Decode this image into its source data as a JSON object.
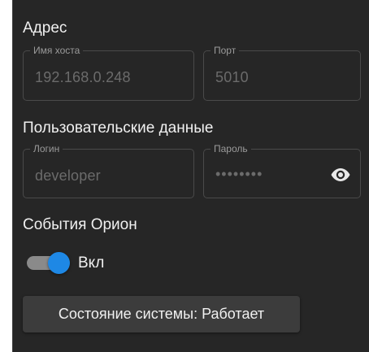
{
  "address": {
    "title": "Адрес",
    "host": {
      "label": "Имя хоста",
      "value": "192.168.0.248"
    },
    "port": {
      "label": "Порт",
      "value": "5010"
    }
  },
  "credentials": {
    "title": "Пользовательские данные",
    "login": {
      "label": "Логин",
      "value": "developer"
    },
    "password": {
      "label": "Пароль",
      "value": "••••••••",
      "toggle_icon": "eye-icon"
    }
  },
  "events": {
    "title": "События Орион",
    "toggle": {
      "label": "Вкл",
      "state": "on",
      "color": "#1e88e5"
    }
  },
  "status_button": {
    "label": "Состояние системы: Работает"
  }
}
